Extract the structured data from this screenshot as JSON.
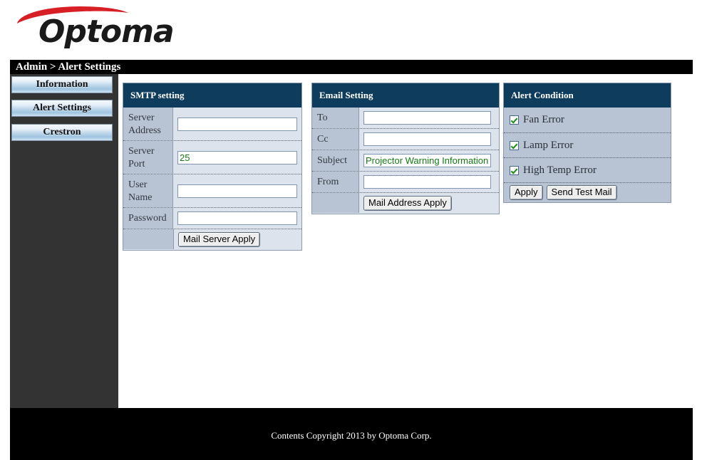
{
  "brand": {
    "logo_text": "Optoma",
    "logo_icon": "optoma-swoosh-icon",
    "accent_color": "#d81f26"
  },
  "breadcrumb": {
    "text": "Admin > Alert Settings"
  },
  "sidebar": {
    "items": [
      {
        "label": "Information"
      },
      {
        "label": "Alert Settings"
      },
      {
        "label": "Crestron"
      }
    ]
  },
  "smtp_setting": {
    "title": "SMTP setting",
    "fields": [
      {
        "label": "Server Address",
        "value": "",
        "placeholder": ""
      },
      {
        "label": "Server Port",
        "value": "25",
        "placeholder": ""
      },
      {
        "label": "User Name",
        "value": "",
        "placeholder": ""
      },
      {
        "label": "Password",
        "value": "",
        "placeholder": ""
      }
    ],
    "apply_button": "Mail Server Apply"
  },
  "email_setting": {
    "title": "Email Setting",
    "fields": [
      {
        "label": "To",
        "value": "",
        "placeholder": ""
      },
      {
        "label": "Cc",
        "value": "",
        "placeholder": ""
      },
      {
        "label": "Subject",
        "value": "Projector Warning Information !",
        "placeholder": ""
      },
      {
        "label": "From",
        "value": "",
        "placeholder": ""
      }
    ],
    "apply_button": "Mail Address Apply"
  },
  "alert_condition": {
    "title": "Alert Condition",
    "conditions": [
      {
        "label": "Fan Error",
        "checked": true
      },
      {
        "label": "Lamp Error",
        "checked": true
      },
      {
        "label": "High Temp Error",
        "checked": true
      }
    ],
    "apply_button": "Apply",
    "test_button": "Send Test Mail"
  },
  "footer": {
    "text": "Contents Copyright 2013 by Optoma Corp."
  },
  "colors": {
    "panel_header": "#0d3c5c",
    "label_cell": "#b8c4d4",
    "field_cell": "#dde3ec",
    "input_text_green": "#157a15",
    "sidebar_dark": "#333333"
  }
}
